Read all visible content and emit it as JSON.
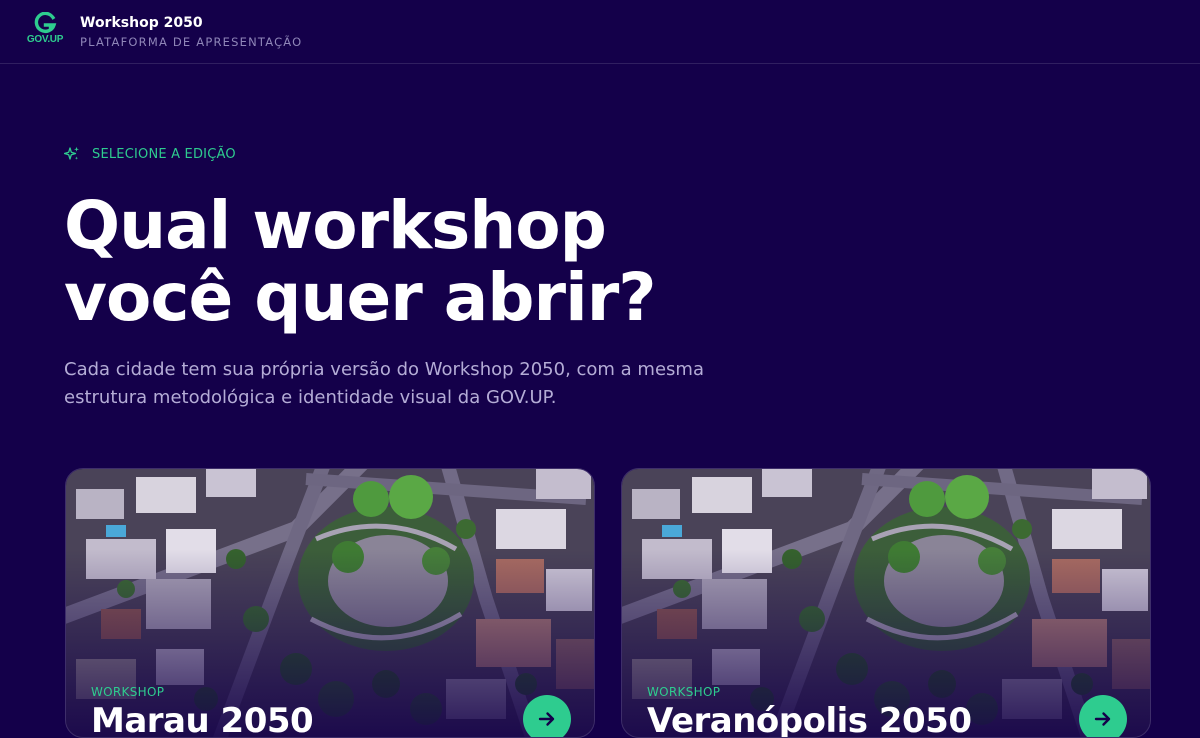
{
  "header": {
    "logo_text": "GOV.UP",
    "title": "Workshop 2050",
    "subtitle": "PLATAFORMA DE APRESENTAÇÃO"
  },
  "hero": {
    "eyebrow": "SELECIONE A EDIÇÃO",
    "headline_line1": "Qual workshop",
    "headline_line2": "você quer abrir?",
    "lead": "Cada cidade tem sua própria versão do Workshop 2050, com a mesma estrutura metodológica e identidade visual da GOV.UP."
  },
  "cards": [
    {
      "tag": "WORKSHOP",
      "city": "Marau 2050"
    },
    {
      "tag": "WORKSHOP",
      "city": "Veranópolis 2050"
    }
  ],
  "colors": {
    "background": "#14004a",
    "accent": "#2ecc8f",
    "muted_text": "#b4acd6"
  },
  "icons": {
    "eyebrow": "sparkles-icon",
    "card_action": "arrow-right-icon"
  }
}
